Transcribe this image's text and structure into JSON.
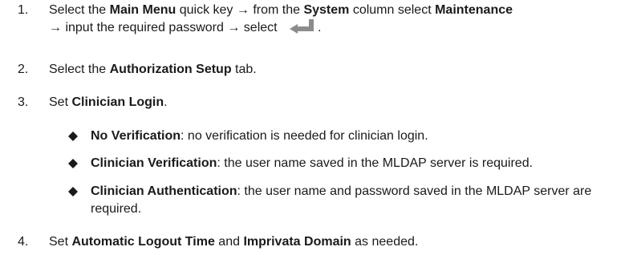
{
  "steps": [
    {
      "number": "1.",
      "parts": {
        "a": "Select the ",
        "b": "Main Menu",
        "c": " quick key → from the ",
        "d": "System",
        "e": " column select ",
        "f": "Maintenance",
        "g": "→ input the required password → select ",
        "h": "."
      },
      "icon": "enter-key-icon"
    },
    {
      "number": "2.",
      "parts": {
        "a": "Select the ",
        "b": "Authorization Setup",
        "c": " tab."
      }
    },
    {
      "number": "3.",
      "parts": {
        "a": "Set ",
        "b": "Clinician Login",
        "c": "."
      }
    },
    {
      "number": "4.",
      "parts": {
        "a": "Set ",
        "b": "Automatic Logout Time",
        "c": " and ",
        "d": "Imprivata Domain",
        "e": " as needed."
      }
    }
  ],
  "bullets": [
    {
      "term": "No Verification",
      "desc": ": no verification is needed for clinician login."
    },
    {
      "term": "Clinician Verification",
      "desc": ": the user name saved in the MLDAP server is required."
    },
    {
      "term": "Clinician Authentication",
      "desc": ": the user name and password saved in the MLDAP server are required."
    }
  ],
  "colors": {
    "text": "#1a1a1a",
    "icon": "#8c8c8c"
  }
}
